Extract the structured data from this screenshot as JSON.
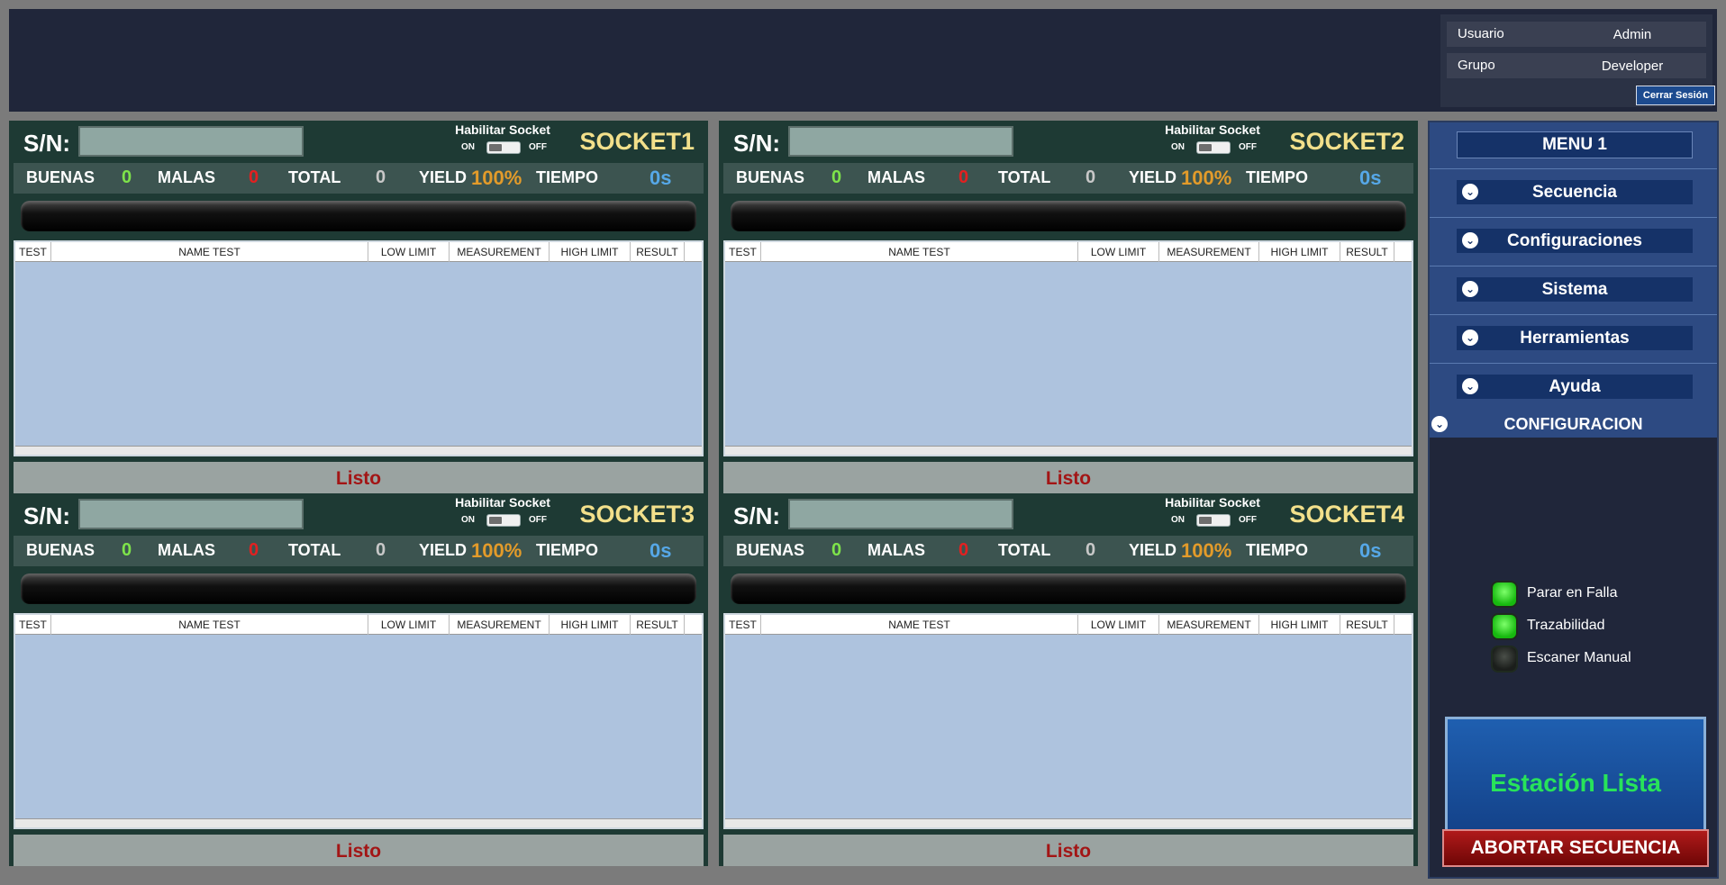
{
  "user_panel": {
    "user_label": "Usuario",
    "user_value": "Admin",
    "group_label": "Grupo",
    "group_value": "Developer",
    "logout_label": "Cerrar Sesión"
  },
  "common": {
    "sn_label": "S/N:",
    "enable_label": "Habilitar Socket",
    "on_label": "ON",
    "off_label": "OFF",
    "good_label": "BUENAS",
    "bad_label": "MALAS",
    "total_label": "TOTAL",
    "yield_label": "YIELD",
    "time_label": "TIEMPO",
    "columns": [
      "TEST",
      "NAME TEST",
      "LOW LIMIT",
      "MEASUREMENT",
      "HIGH LIMIT",
      "RESULT"
    ]
  },
  "sockets": [
    {
      "title": "SOCKET1",
      "sn": "",
      "good": "0",
      "bad": "0",
      "total": "0",
      "yield": "100%",
      "time": "0s",
      "status": "Listo",
      "enabled": false
    },
    {
      "title": "SOCKET2",
      "sn": "",
      "good": "0",
      "bad": "0",
      "total": "0",
      "yield": "100%",
      "time": "0s",
      "status": "Listo",
      "enabled": false
    },
    {
      "title": "SOCKET3",
      "sn": "",
      "good": "0",
      "bad": "0",
      "total": "0",
      "yield": "100%",
      "time": "0s",
      "status": "Listo",
      "enabled": false
    },
    {
      "title": "SOCKET4",
      "sn": "",
      "good": "0",
      "bad": "0",
      "total": "0",
      "yield": "100%",
      "time": "0s",
      "status": "Listo",
      "enabled": false
    }
  ],
  "menu": {
    "title": "MENU 1",
    "items": [
      "Secuencia",
      "Configuraciones",
      "Sistema",
      "Herramientas",
      "Ayuda"
    ],
    "config_label": "CONFIGURACION"
  },
  "options": [
    {
      "label": "Parar en Falla",
      "on": true
    },
    {
      "label": "Trazabilidad",
      "on": true
    },
    {
      "label": "Escaner Manual",
      "on": false
    }
  ],
  "station_status": "Estación Lista",
  "abort_label": "ABORTAR SECUENCIA",
  "colors": {
    "background": "#7b7b7b",
    "header": "#20263a",
    "socket_bg": "#1e3a34",
    "table_bg": "#aec3de",
    "menu_blue": "#2d4a82",
    "good_green": "#7ee34a",
    "bad_red": "#e32020",
    "yield_orange": "#e39b2a",
    "time_blue": "#56a8e8",
    "title_yellow": "#f3e08b",
    "status_red": "#a31515"
  }
}
